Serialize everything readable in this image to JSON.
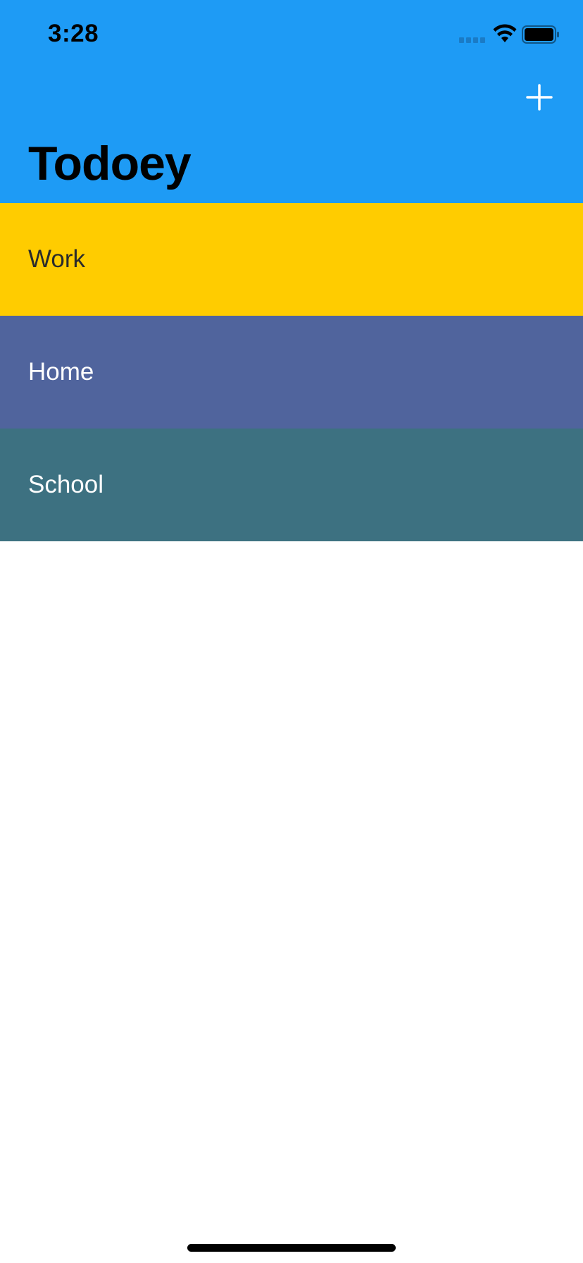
{
  "status_bar": {
    "time": "3:28"
  },
  "nav": {
    "title": "Todoey",
    "add_icon": "plus-icon",
    "background": "#1e9bf5"
  },
  "categories": [
    {
      "name": "Work",
      "color": "#ffcc00",
      "text_color": "#2b2b2b"
    },
    {
      "name": "Home",
      "color": "#50649d",
      "text_color": "#ffffff"
    },
    {
      "name": "School",
      "color": "#3d7181",
      "text_color": "#ffffff"
    }
  ]
}
